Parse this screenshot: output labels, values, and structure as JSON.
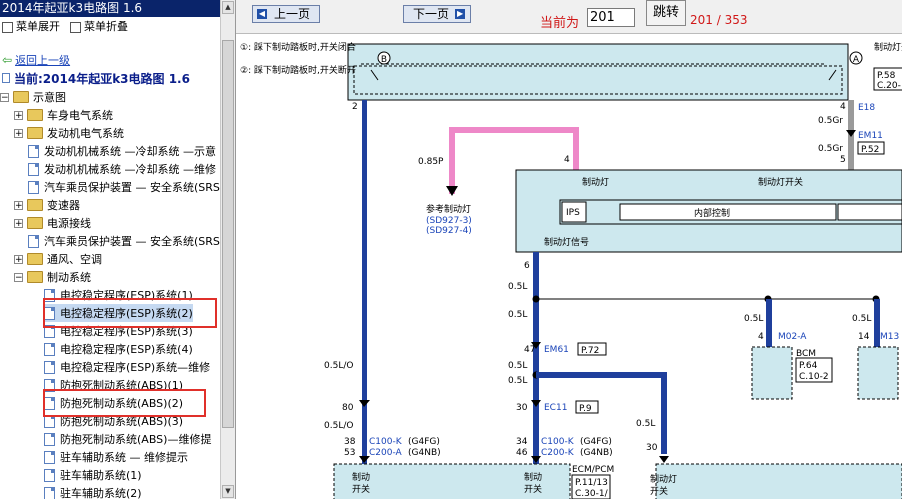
{
  "window_title": "2014年起亚k3电路图 1.6",
  "menu": {
    "expand": "菜单展开",
    "collapse": "菜单折叠"
  },
  "nav": {
    "back_up": "返回上一级",
    "current_label": "当前:2014年起亚k3电路图 1.6"
  },
  "tree": {
    "root": "示意图",
    "items": [
      {
        "label": "车身电气系统"
      },
      {
        "label": "发动机电气系统"
      },
      {
        "label": "发动机机械系统 —冷却系统 —示意"
      },
      {
        "label": "发动机机械系统 —冷却系统 —维修"
      },
      {
        "label": "汽车乘员保护装置 — 安全系统(SRS"
      },
      {
        "label": "变速器"
      },
      {
        "label": "电源接线"
      },
      {
        "label": "汽车乘员保护装置 — 安全系统(SRS"
      },
      {
        "label": "通风、空调"
      },
      {
        "label": "制动系统"
      },
      {
        "label": "电控稳定程序(ESP)系统(1)"
      },
      {
        "label": "电控稳定程序(ESP)系统(2)"
      },
      {
        "label": "电控稳定程序(ESP)系统(3)"
      },
      {
        "label": "电控稳定程序(ESP)系统(4)"
      },
      {
        "label": "电控稳定程序(ESP)系统—维修"
      },
      {
        "label": "防抱死制动系统(ABS)(1)"
      },
      {
        "label": "防抱死制动系统(ABS)(2)"
      },
      {
        "label": "防抱死制动系统(ABS)(3)"
      },
      {
        "label": "防抱死制动系统(ABS)—维修提"
      },
      {
        "label": "驻车辅助系统 — 维修提示"
      },
      {
        "label": "驻车辅助系统(1)"
      },
      {
        "label": "驻车辅助系统(2)"
      }
    ]
  },
  "toolbar": {
    "prev": "上一页",
    "next": "下一页",
    "current_label": "当前为",
    "page_value": "201",
    "jump": "跳转",
    "page_count": "201 / 353"
  },
  "diagram": {
    "switch_note_b": "踩下制动踏板时,开关闭合",
    "switch_note_a": "踩下制动踏板时,开关断开",
    "brake_switch": "制动灯开关",
    "p58": "P.58",
    "c20": "C.20-",
    "pin2": "2",
    "pin4a": "4",
    "e18": "E18",
    "gr05a": "0.5Gr",
    "em11": "EM11",
    "gr05b": "0.5Gr",
    "pin5": "5",
    "p52": "P.52",
    "p085": "0.85P",
    "pin4b": "4",
    "ref_lamp": "参考制动灯",
    "sd3": "(SD927-3)",
    "sd4": "(SD927-4)",
    "brake_lamp": "制动灯",
    "brake_switch2": "制动灯开关",
    "ips": "IPS",
    "internal": "内部控制",
    "signal": "制动灯信号",
    "pin6": "6",
    "l05a": "0.5L",
    "l05b": "0.5L",
    "l05c": "0.5L",
    "l05d": "0.5L",
    "pin4c": "4",
    "m02a": "M02-A",
    "pin14": "14",
    "m13": "M13",
    "bcm": "BCM",
    "p64": "P.64",
    "c102": "C.10-2",
    "pin47": "47",
    "em61": "EM61",
    "p72": "P.72",
    "l05e": "0.5L",
    "lo05a": "0.5L/O",
    "pin80": "80",
    "pin30a": "30",
    "ec11": "EC11",
    "p9": "P.9",
    "l05f": "0.5L",
    "l05g": "0.5L",
    "lo05b": "0.5L/O",
    "pin30b": "30",
    "pin38": "38",
    "pin53": "53",
    "c100a": "C100-K",
    "g4fga": "(G4FG)",
    "c200a": "C200-A",
    "g4nba": "(G4NB)",
    "pin34": "34",
    "pin46": "46",
    "c100b": "C100-K",
    "g4fgb": "(G4FG)",
    "c200b": "C200-K",
    "g4nbb": "(G4NB)",
    "ecmpcm": "ECM/PCM",
    "p1113": "P.11/13",
    "c30": "C.30-1/",
    "sw_a1": "制动",
    "sw_a2": "开关",
    "sw_b1": "制动",
    "sw_b2": "开关",
    "sw_c1": "制动灯",
    "sw_c2": "开关",
    "circ_b": "B",
    "circ_a": "A"
  }
}
